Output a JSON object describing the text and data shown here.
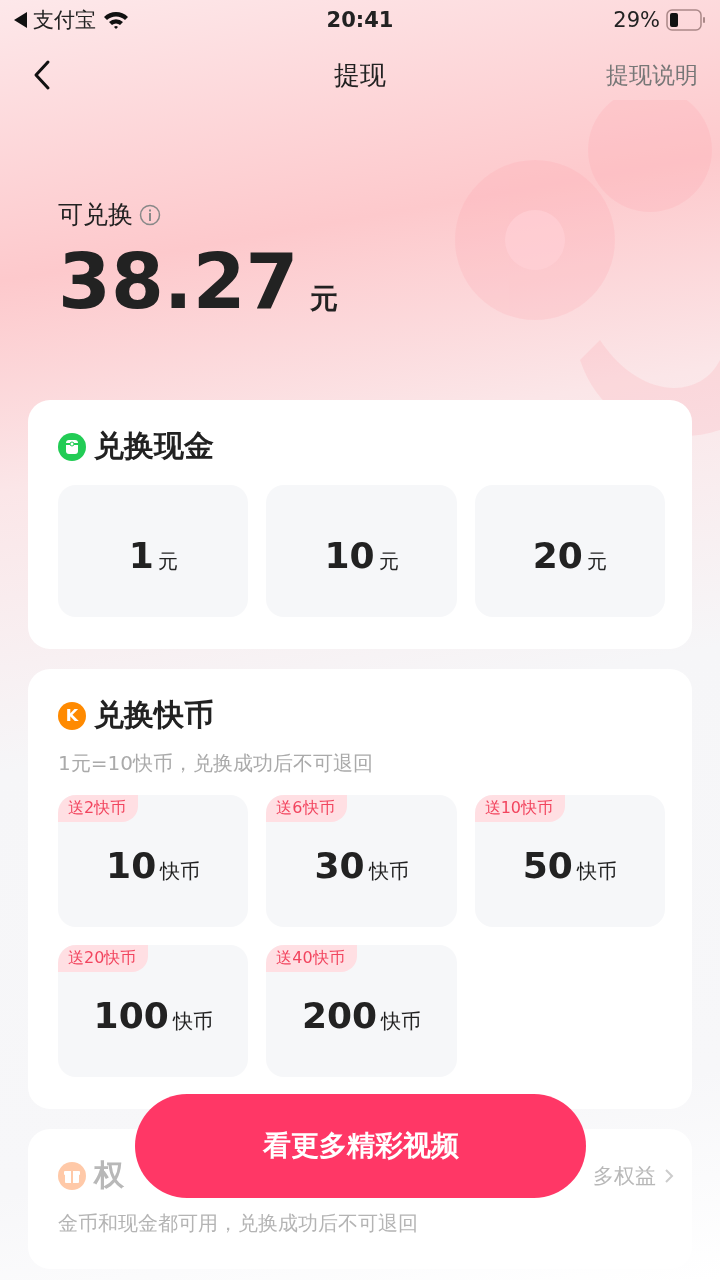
{
  "status_bar": {
    "back_app": "支付宝",
    "time": "20:41",
    "battery": "29%"
  },
  "nav": {
    "title": "提现",
    "action": "提现说明"
  },
  "balance": {
    "label": "可兑换",
    "amount": "38.27",
    "unit": "元"
  },
  "sections": [
    {
      "title": "兑换现金",
      "icon": {
        "kind": "wallet"
      },
      "options": [
        {
          "amount": "1",
          "unit": "元"
        },
        {
          "amount": "10",
          "unit": "元"
        },
        {
          "amount": "20",
          "unit": "元"
        }
      ]
    },
    {
      "title": "兑换快币",
      "icon": {
        "kind": "letter",
        "letter": "K"
      },
      "note": "1元=10快币，兑换成功后不可退回",
      "options": [
        {
          "amount": "10",
          "unit": "快币",
          "badge": "送2快币"
        },
        {
          "amount": "30",
          "unit": "快币",
          "badge": "送6快币"
        },
        {
          "amount": "50",
          "unit": "快币",
          "badge": "送10快币"
        },
        {
          "amount": "100",
          "unit": "快币",
          "badge": "送20快币"
        },
        {
          "amount": "200",
          "unit": "快币",
          "badge": "送40快币"
        }
      ]
    },
    {
      "title": "权",
      "icon": {
        "kind": "gift"
      },
      "link": "多权益",
      "note": "金币和现金都可用，兑换成功后不可退回",
      "faded": true
    }
  ],
  "cta": "看更多精彩视频"
}
